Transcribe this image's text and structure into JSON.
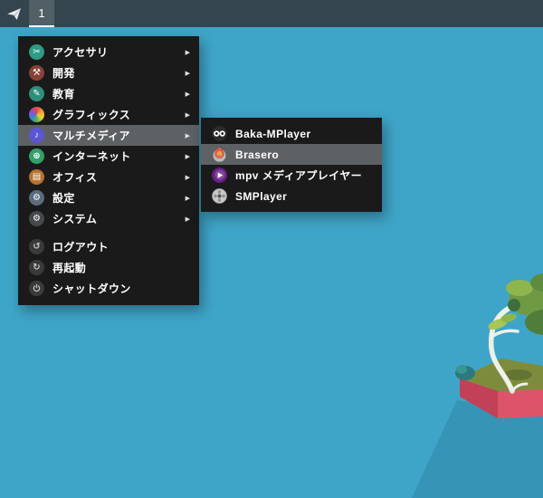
{
  "theme": {
    "desktop_bg": "#3fa5c8",
    "topbar_bg": "#35454d",
    "menu_bg": "#1a1a1a",
    "highlight": "#5d6164",
    "text": "#ffffff",
    "action_icon_bg": "#3a3a3a",
    "action_icon_glyph": "#c7c7c7"
  },
  "topbar": {
    "launcher_icon": "paper-plane",
    "workspace": "1"
  },
  "menu": {
    "submenu_arrow": "▶",
    "categories": [
      {
        "label": "アクセサリ",
        "icon": "accessories",
        "icon_color": "#2e9b84",
        "selected": false
      },
      {
        "label": "開発",
        "icon": "development",
        "icon_color": "#8a4038",
        "selected": false
      },
      {
        "label": "教育",
        "icon": "education",
        "icon_color": "#2f8f7a",
        "selected": false
      },
      {
        "label": "グラフィックス",
        "icon": "graphics",
        "icon_color": "rainbow",
        "selected": false
      },
      {
        "label": "マルチメディア",
        "icon": "multimedia",
        "icon_color": "#5b55d6",
        "selected": true
      },
      {
        "label": "インターネット",
        "icon": "internet",
        "icon_color": "#31a06a",
        "selected": false
      },
      {
        "label": "オフィス",
        "icon": "office",
        "icon_color": "#b5722f",
        "selected": false
      },
      {
        "label": "設定",
        "icon": "settings",
        "icon_color": "#5b6d7c",
        "selected": false
      },
      {
        "label": "システム",
        "icon": "system",
        "icon_color": "#45494c",
        "selected": false
      }
    ],
    "actions": [
      {
        "label": "ログアウト",
        "icon": "logout"
      },
      {
        "label": "再起動",
        "icon": "restart"
      },
      {
        "label": "シャットダウン",
        "icon": "shutdown"
      }
    ]
  },
  "submenu": {
    "items": [
      {
        "label": "Baka-MPlayer",
        "icon": "baka-mplayer",
        "selected": false
      },
      {
        "label": "Brasero",
        "icon": "brasero",
        "selected": true
      },
      {
        "label": "mpv メディアプレイヤー",
        "icon": "mpv",
        "selected": false
      },
      {
        "label": "SMPlayer",
        "icon": "smplayer",
        "selected": false
      }
    ]
  }
}
